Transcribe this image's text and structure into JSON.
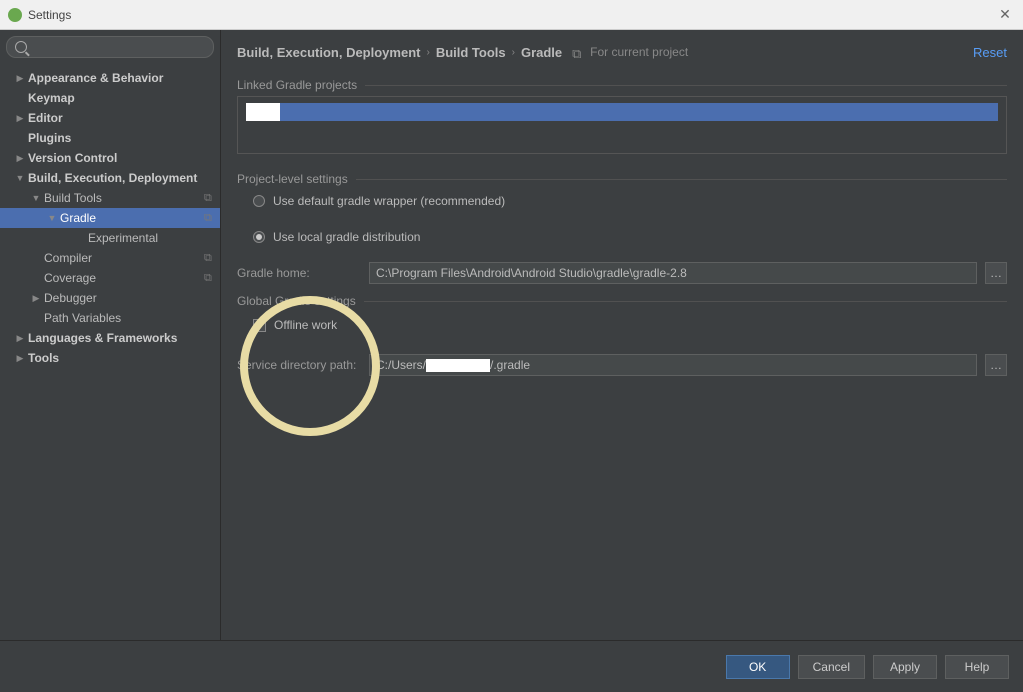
{
  "window": {
    "title": "Settings"
  },
  "breadcrumb": {
    "c1": "Build, Execution, Deployment",
    "c2": "Build Tools",
    "c3": "Gradle",
    "scope": "For current project",
    "reset": "Reset"
  },
  "sidebar": {
    "items": [
      {
        "label": "Appearance & Behavior",
        "bold": true,
        "arrow": "right",
        "indent": 0
      },
      {
        "label": "Keymap",
        "bold": true,
        "indent": 0
      },
      {
        "label": "Editor",
        "bold": true,
        "arrow": "right",
        "indent": 0
      },
      {
        "label": "Plugins",
        "bold": true,
        "indent": 0
      },
      {
        "label": "Version Control",
        "bold": true,
        "arrow": "right",
        "indent": 0
      },
      {
        "label": "Build, Execution, Deployment",
        "bold": true,
        "arrow": "down",
        "indent": 0
      },
      {
        "label": "Build Tools",
        "arrow": "down",
        "indent": 1,
        "copy": true
      },
      {
        "label": "Gradle",
        "arrow": "down",
        "indent": 2,
        "selected": true,
        "copy": true
      },
      {
        "label": "Experimental",
        "indent": 3
      },
      {
        "label": "Compiler",
        "indent": 1,
        "copy": true
      },
      {
        "label": "Coverage",
        "indent": 1,
        "copy": true
      },
      {
        "label": "Debugger",
        "arrow": "right",
        "indent": 1
      },
      {
        "label": "Path Variables",
        "indent": 1
      },
      {
        "label": "Languages & Frameworks",
        "bold": true,
        "arrow": "right",
        "indent": 0
      },
      {
        "label": "Tools",
        "bold": true,
        "arrow": "right",
        "indent": 0
      }
    ]
  },
  "sections": {
    "linked": "Linked Gradle projects",
    "project": "Project-level settings",
    "global": "Global Gradle settings"
  },
  "radios": {
    "default_wrapper": "Use default gradle wrapper (recommended)",
    "local_dist": "Use local gradle distribution"
  },
  "fields": {
    "gradle_home_label": "Gradle home:",
    "gradle_home_value": "C:\\Program Files\\Android\\Android Studio\\gradle\\gradle-2.8",
    "service_dir_label": "Service directory path:",
    "service_dir_prefix": "C:/Users/",
    "service_dir_suffix": "/.gradle"
  },
  "checks": {
    "offline": "Offline work"
  },
  "footer": {
    "ok": "OK",
    "cancel": "Cancel",
    "apply": "Apply",
    "help": "Help"
  }
}
